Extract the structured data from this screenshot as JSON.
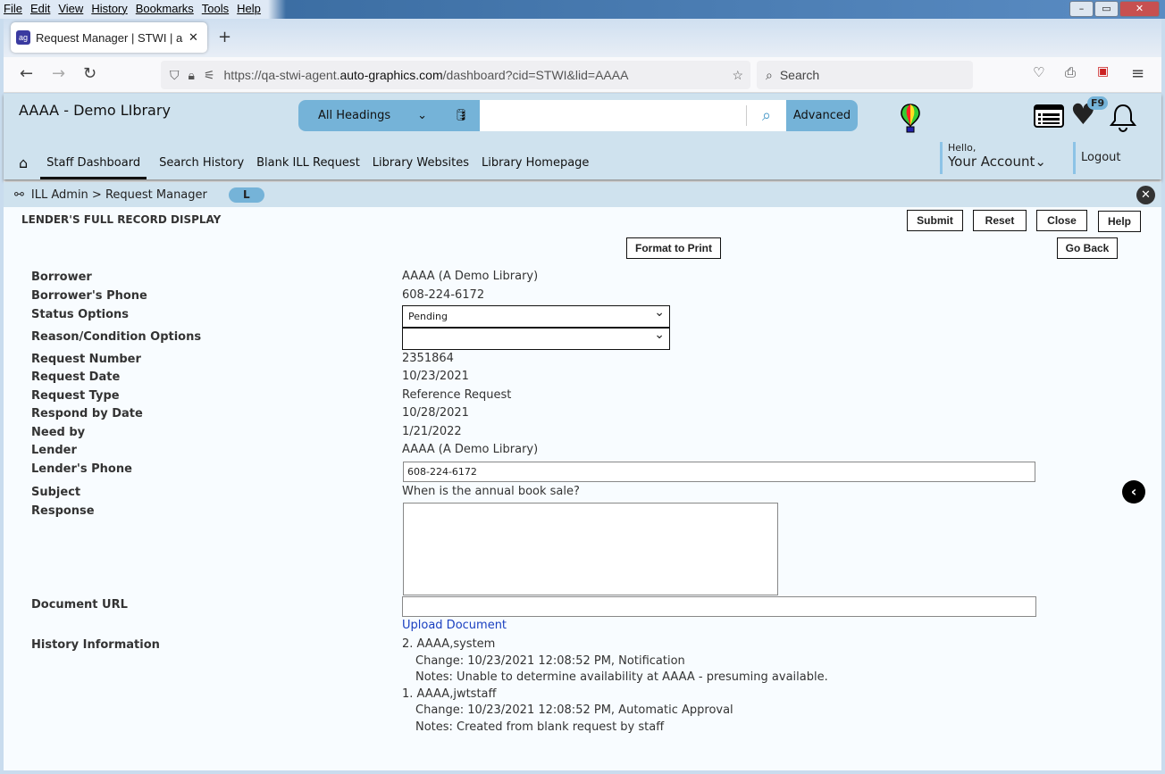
{
  "browser": {
    "menu": [
      "File",
      "Edit",
      "View",
      "History",
      "Bookmarks",
      "Tools",
      "Help"
    ],
    "tab_title": "Request Manager | STWI | aaaa |",
    "url_pre": "https://qa-stwi-agent.",
    "url_domain": "auto-graphics.com",
    "url_post": "/dashboard?cid=STWI&lid=AAAA",
    "search_placeholder": "Search"
  },
  "header": {
    "library_name": "AAAA - Demo LIbrary",
    "search_type": "All Headings",
    "search_value": "",
    "advanced": "Advanced",
    "badge": "F9",
    "hello": "Hello,",
    "account": "Your Account",
    "logout": "Logout"
  },
  "nav": [
    "Staff Dashboard",
    "Search History",
    "Blank ILL Request",
    "Library Websites",
    "Library Homepage"
  ],
  "breadcrumb": {
    "text": "ILL Admin > Request Manager",
    "pill": "L"
  },
  "page": {
    "title": "LENDER'S FULL RECORD DISPLAY",
    "buttons": {
      "submit": "Submit",
      "reset": "Reset",
      "close": "Close",
      "help": "Help",
      "format": "Format to Print",
      "goback": "Go Back"
    }
  },
  "form": {
    "borrower": {
      "label": "Borrower",
      "value": "AAAA (A Demo Library)"
    },
    "borrower_phone": {
      "label": "Borrower's Phone",
      "value": "608-224-6172"
    },
    "status": {
      "label": "Status Options",
      "value": "Pending"
    },
    "reason": {
      "label": "Reason/Condition Options",
      "value": ""
    },
    "request_number": {
      "label": "Request Number",
      "value": "2351864"
    },
    "request_date": {
      "label": "Request Date",
      "value": "10/23/2021"
    },
    "request_type": {
      "label": "Request Type",
      "value": "Reference Request"
    },
    "respond_by": {
      "label": "Respond by Date",
      "value": "10/28/2021"
    },
    "need_by": {
      "label": "Need by",
      "value": "1/21/2022"
    },
    "lender": {
      "label": "Lender",
      "value": "AAAA (A Demo Library)"
    },
    "lender_phone": {
      "label": "Lender's Phone",
      "value": "608-224-6172"
    },
    "subject": {
      "label": "Subject",
      "value": "When is the annual book sale?"
    },
    "response": {
      "label": "Response",
      "value": ""
    },
    "document_url": {
      "label": "Document URL",
      "value": ""
    },
    "upload": "Upload Document",
    "history_label": "History Information",
    "history": [
      {
        "head": "2. AAAA,system",
        "change": "Change: 10/23/2021 12:08:52 PM, Notification",
        "notes": "Notes: Unable to determine availability at AAAA - presuming available."
      },
      {
        "head": "1. AAAA,jwtstaff",
        "change": "Change: 10/23/2021 12:08:52 PM, Automatic Approval",
        "notes": "Notes: Created from blank request by staff"
      }
    ]
  }
}
